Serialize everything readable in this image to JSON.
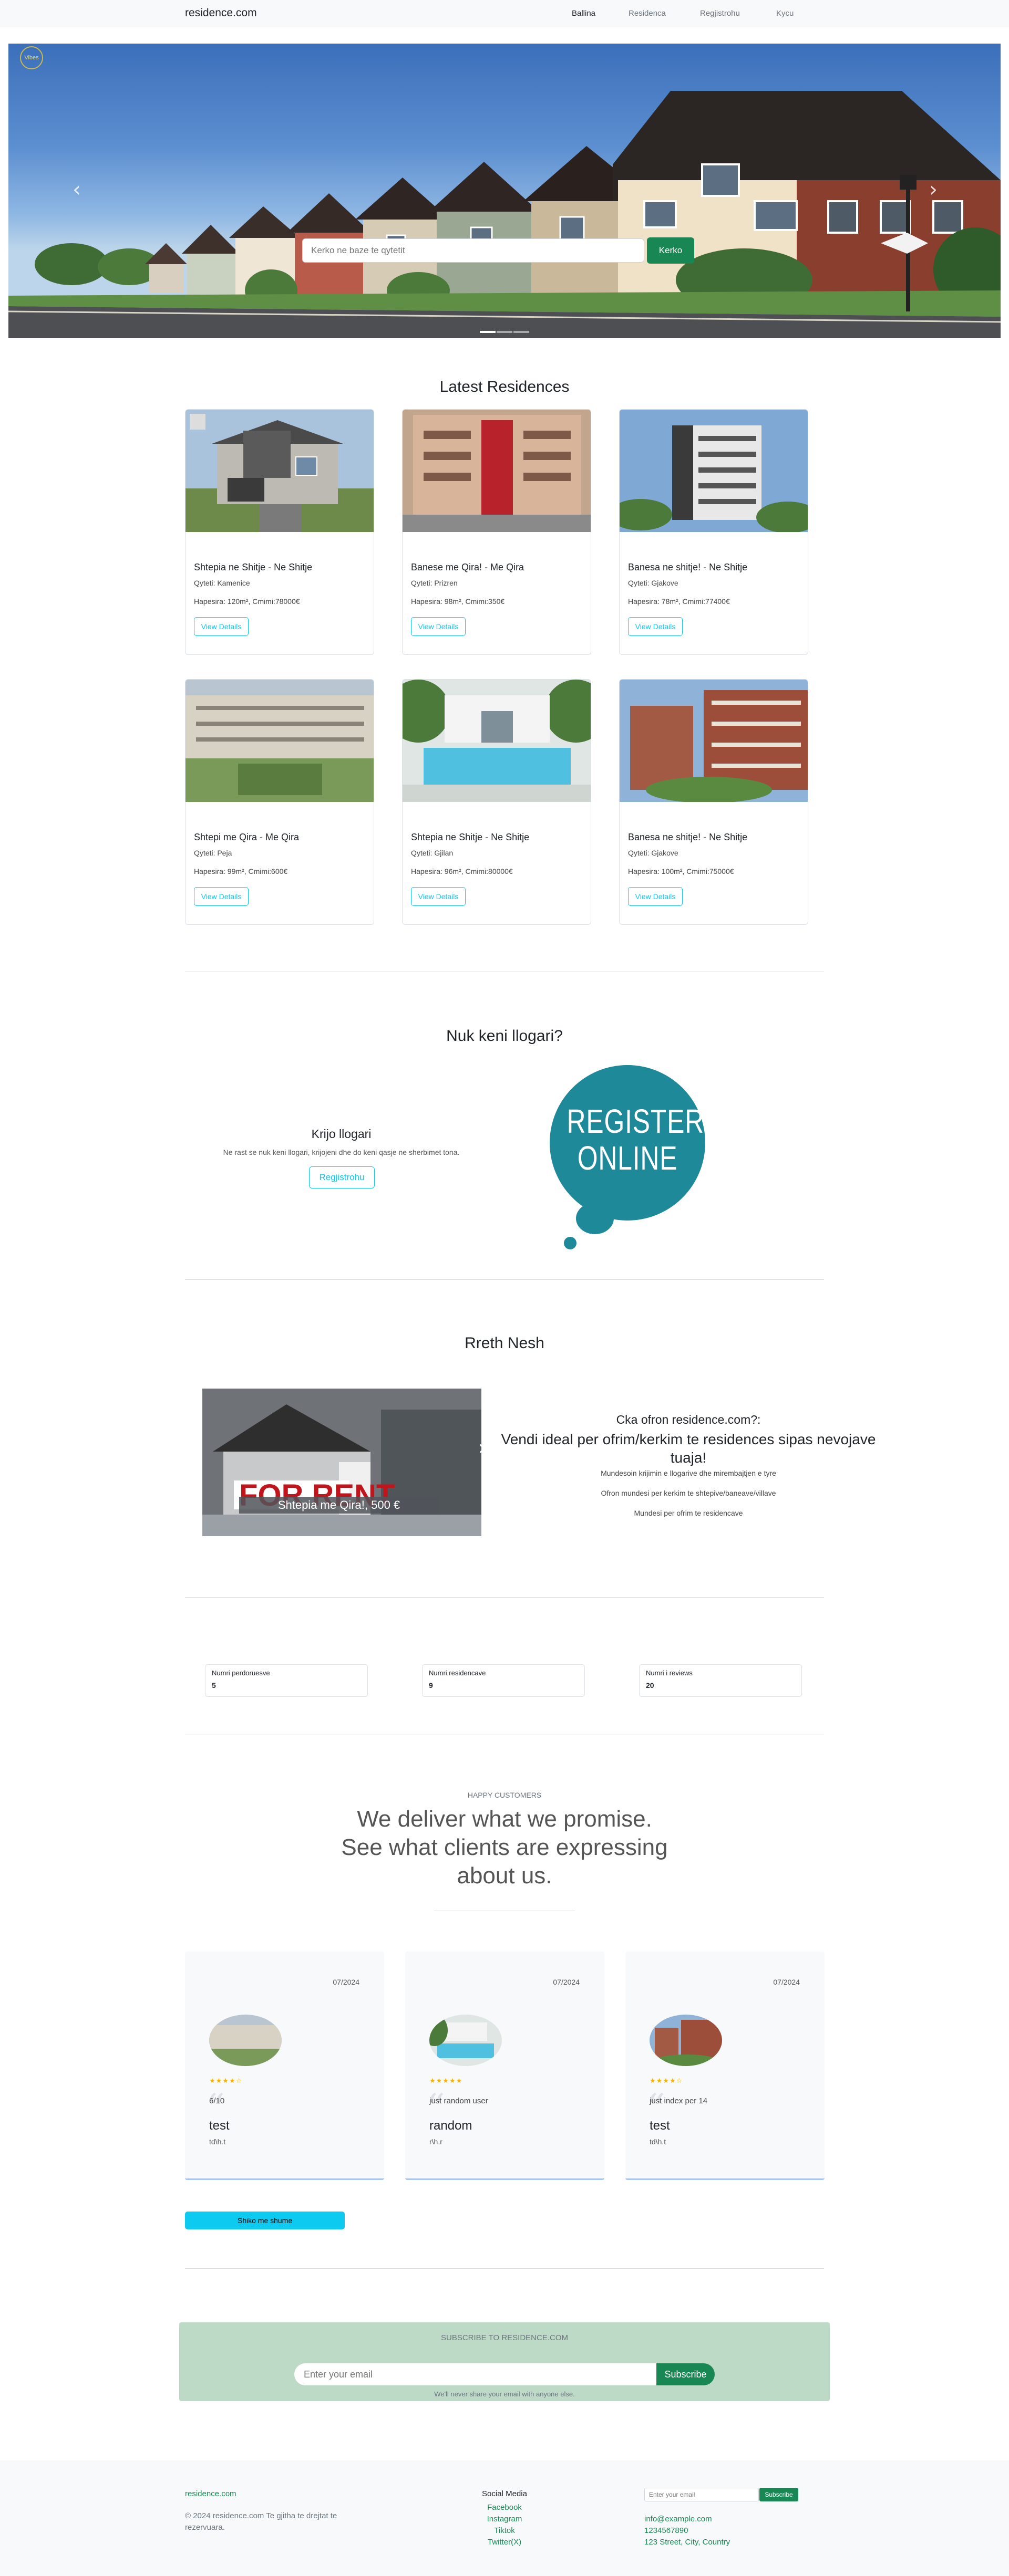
{
  "navbar": {
    "brand": "residence.com",
    "links": [
      "Ballina",
      "Residenca",
      "Regjistrohu",
      "Kycu"
    ]
  },
  "hero": {
    "logo_text": "Vibes",
    "search_placeholder": "Kerko ne baze te qytetit",
    "search_button": "Kerko",
    "prev_arrow": "‹",
    "next_arrow": "›",
    "slides_count": 3,
    "active_slide": 1
  },
  "latest": {
    "title": "Latest Residences",
    "cards": [
      {
        "title": "Shtepia ne Shitje - Ne Shitje",
        "city": "Qyteti: Kamenice",
        "info": "Hapesira: 120m², Cmimi:78000€",
        "button": "View Details"
      },
      {
        "title": "Banese me Qira! - Me Qira",
        "city": "Qyteti: Prizren",
        "info": "Hapesira: 98m², Cmimi:350€",
        "button": "View Details"
      },
      {
        "title": "Banesa ne shitje! - Ne Shitje",
        "city": "Qyteti: Gjakove",
        "info": "Hapesira: 78m², Cmimi:77400€",
        "button": "View Details"
      },
      {
        "title": "Shtepi me Qira - Me Qira",
        "city": "Qyteti: Peja",
        "info": "Hapesira: 99m², Cmimi:600€",
        "button": "View Details"
      },
      {
        "title": "Shtepia ne Shitje - Ne Shitje",
        "city": "Qyteti: Gjilan",
        "info": "Hapesira: 96m², Cmimi:80000€",
        "button": "View Details"
      },
      {
        "title": "Banesa ne shitje! - Ne Shitje",
        "city": "Qyteti: Gjakove",
        "info": "Hapesira: 100m², Cmimi:75000€",
        "button": "View Details"
      }
    ]
  },
  "register": {
    "title": "Nuk keni llogari?",
    "card_title": "Krijo llogari",
    "card_text": "Ne rast se nuk keni llogari, krijojeni dhe do keni qasje ne sherbimet tona.",
    "button": "Regjistrohu",
    "graphic_line1": "REGISTER",
    "graphic_line2": "ONLINE"
  },
  "about": {
    "title": "Rreth Nesh",
    "image_caption": "Shtepia me Qira!, 500 €",
    "sign_text": "FOR RENT",
    "question": "Cka ofron residence.com?:",
    "headline": "Vendi ideal per ofrim/kerkim te residences sipas nevojave tuaja!",
    "points": [
      "Mundesoin krijimin e llogarive dhe mirembajtjen e tyre",
      "Ofron mundesi per kerkim te shtepive/baneave/villave",
      "Mundesi per ofrim te residencave"
    ]
  },
  "stats": [
    {
      "label": "Numri perdoruesve",
      "value": "5"
    },
    {
      "label": "Numri residencave",
      "value": "9"
    },
    {
      "label": "Numri i reviews",
      "value": "20"
    }
  ],
  "testimonials": {
    "eyebrow": "HAPPY CUSTOMERS",
    "heading_lines": [
      "We deliver what we promise.",
      "See what clients are expressing",
      "about us."
    ],
    "items": [
      {
        "date": "07/2024",
        "stars": "★★★★☆",
        "review": "6/10",
        "name": "test",
        "sub": "td\\h.t"
      },
      {
        "date": "07/2024",
        "stars": "★★★★★",
        "review": "just random user",
        "name": "random",
        "sub": "r\\h.r"
      },
      {
        "date": "07/2024",
        "stars": "★★★★☆",
        "review": "just index per 14",
        "name": "test",
        "sub": "td\\h.t"
      }
    ],
    "all_button": "Shiko me shume"
  },
  "subscribe": {
    "title": "SUBSCRIBE TO RESIDENCE.COM",
    "placeholder": "Enter your email",
    "button": "Subscribe",
    "note": "We'll never share your email with anyone else."
  },
  "footer": {
    "brand": "residence.com",
    "copyright": "© 2024 residence.com Te gjitha te drejtat te rezervuara.",
    "social_title": "Social Media",
    "social": [
      "Facebook",
      "Instagram",
      "Tiktok",
      "Twitter(X)"
    ],
    "email_placeholder": "Enter your email",
    "subscribe_button": "Subscribe",
    "contact": [
      "info@example.com",
      "1234567890",
      "123 Street, City, Country"
    ]
  },
  "colors": {
    "accent": "#0dcaf0",
    "success": "#198754",
    "register_bubble": "#1e8999",
    "subscribe_bg": "#bddac7"
  }
}
